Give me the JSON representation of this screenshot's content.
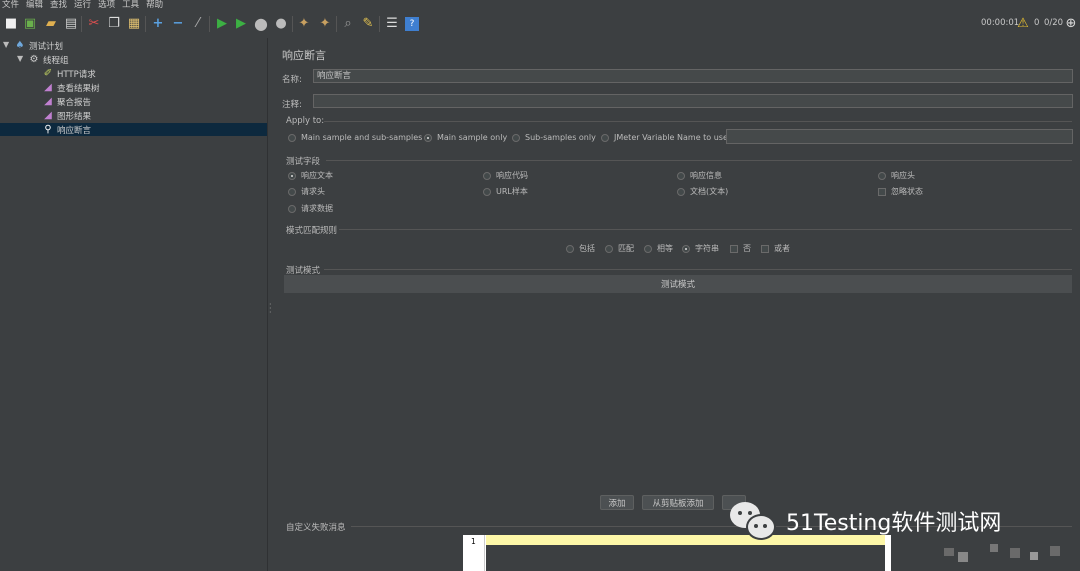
{
  "menu": [
    "文件",
    "编辑",
    "查找",
    "运行",
    "选项",
    "工具",
    "帮助"
  ],
  "toolbar": {
    "icons": [
      "new-icon",
      "templates-icon",
      "open-icon",
      "save-icon",
      "cut-icon",
      "copy-icon",
      "paste-icon",
      "expand-icon",
      "collapse-icon",
      "toggle-icon",
      "start-icon",
      "start-no-pause-icon",
      "stop-icon",
      "shutdown-icon",
      "clear-icon",
      "clear-all-icon",
      "search-icon",
      "reset-search-icon",
      "function-helper-icon",
      "help-icon"
    ],
    "timer": "00:00:01",
    "warning_count": "0",
    "threads": "0/20"
  },
  "tree": {
    "items": [
      {
        "label": "测试计划",
        "icon": "test-plan-icon"
      },
      {
        "label": "线程组",
        "icon": "thread-group-icon"
      },
      {
        "label": "HTTP请求",
        "icon": "sampler-icon"
      },
      {
        "label": "查看结果树",
        "icon": "listener-icon"
      },
      {
        "label": "聚合报告",
        "icon": "listener-icon"
      },
      {
        "label": "图形结果",
        "icon": "listener-icon"
      },
      {
        "label": "响应断言",
        "icon": "assertion-icon"
      }
    ]
  },
  "panel": {
    "title": "响应断言",
    "name_label": "名称:",
    "name_value": "响应断言",
    "comment_label": "注释:",
    "comment_value": "",
    "apply_to": {
      "title": "Apply to:",
      "options": [
        "Main sample and sub-samples",
        "Main sample only",
        "Sub-samples only",
        "JMeter Variable Name to use"
      ],
      "selected": "Main sample only",
      "variable_value": ""
    },
    "field_to_test": {
      "title": "测试字段",
      "options": [
        "响应文本",
        "响应代码",
        "响应信息",
        "响应头",
        "请求头",
        "URL样本",
        "文档(文本)",
        "请求数据"
      ],
      "selected": "响应文本",
      "ignore_status": "忽略状态"
    },
    "pattern_matching": {
      "title": "模式匹配规则",
      "options": [
        "包括",
        "匹配",
        "相等",
        "字符串"
      ],
      "selected": "字符串",
      "not": "否",
      "or": "或者"
    },
    "patterns": {
      "title": "测试模式",
      "column_header": "测试模式"
    },
    "buttons": {
      "add": "添加",
      "add_from_clipboard": "从剪贴板添加"
    },
    "custom_failure": {
      "title": "自定义失败消息",
      "line_number": "1"
    }
  },
  "watermark": "51Testing软件测试网"
}
